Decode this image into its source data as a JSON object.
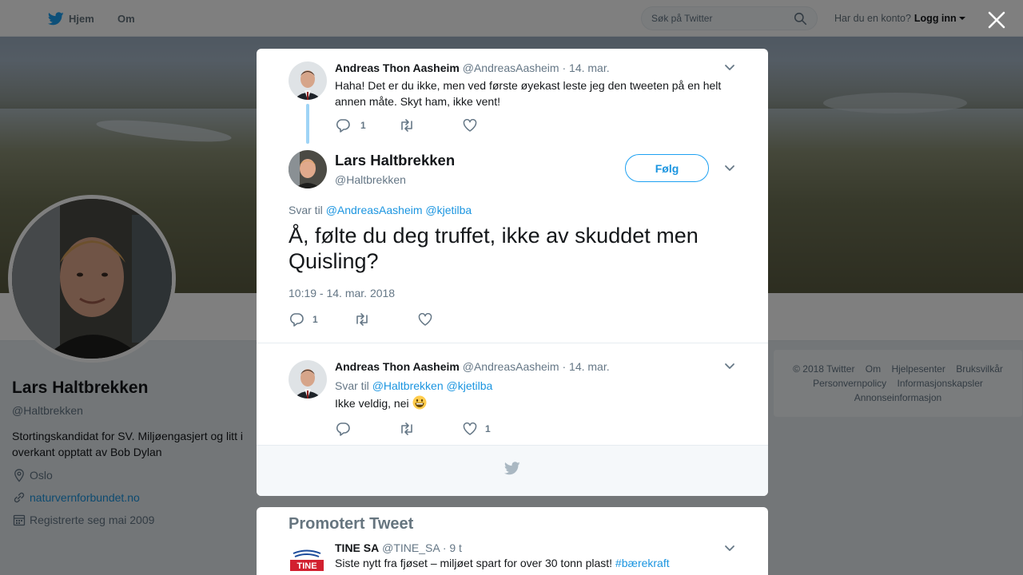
{
  "topbar": {
    "home_label": "Hjem",
    "about_label": "Om",
    "search_placeholder": "Søk på Twitter",
    "account_prompt": "Har du en konto?",
    "login_label": "Logg inn"
  },
  "profile": {
    "name": "Lars Haltbrekken",
    "handle": "@Haltbrekken",
    "bio": "Stortingskandidat for SV. Miljøengasjert og litt i overkant opptatt av Bob Dylan",
    "location": "Oslo",
    "website": "naturvernforbundet.no",
    "joined": "Registrerte seg mai 2009"
  },
  "footer": {
    "links": [
      "© 2018 Twitter",
      "Om",
      "Hjelpesenter",
      "Bruksvilkår",
      "Personvernpolicy",
      "Informasjonskapsler",
      "Annonseinformasjon"
    ]
  },
  "modal": {
    "parent_tweet": {
      "name": "Andreas Thon Aasheim",
      "handle": "@AndreasAasheim",
      "dot": "·",
      "time": "14. mar.",
      "text": "Haha! Det er du ikke, men ved første øyekast leste jeg den tweeten på en helt annen måte. Skyt ham, ikke vent!",
      "reply_count": "1"
    },
    "main_tweet": {
      "name": "Lars Haltbrekken",
      "handle": "@Haltbrekken",
      "follow_label": "Følg",
      "reply_prefix": "Svar til",
      "reply_to_1": "@AndreasAasheim",
      "reply_to_2": "@kjetilba",
      "text": "Å, følte du deg truffet, ikke av skuddet men Quisling?",
      "timestamp": "10:19 - 14. mar. 2018",
      "reply_count": "1"
    },
    "reply_tweet": {
      "name": "Andreas Thon Aasheim",
      "handle": "@AndreasAasheim",
      "dot": "·",
      "time": "14. mar.",
      "reply_prefix": "Svar til",
      "reply_to_1": "@Haltbrekken",
      "reply_to_2": "@kjetilba",
      "text": "Ikke veldig, nei",
      "like_count": "1"
    }
  },
  "promoted": {
    "title": "Promotert Tweet",
    "name": "TINE SA",
    "handle": "@TINE_SA",
    "dot": "·",
    "time": "9 t",
    "text": "Siste nytt fra fjøset – miljøet spart for over 30 tonn plast!",
    "hashtag": "#bærekraft",
    "logo_text": "TINE"
  },
  "colors": {
    "accent": "#1da1f2",
    "link": "#1b95e0",
    "muted": "#657786",
    "thread_line": "#9fd4f6"
  },
  "icons": [
    "twitter-bird-icon",
    "search-icon",
    "close-icon",
    "location-pin-icon",
    "link-icon",
    "calendar-icon",
    "reply-icon",
    "retweet-icon",
    "like-icon",
    "chevron-down-icon",
    "grinning-emoji-icon"
  ]
}
